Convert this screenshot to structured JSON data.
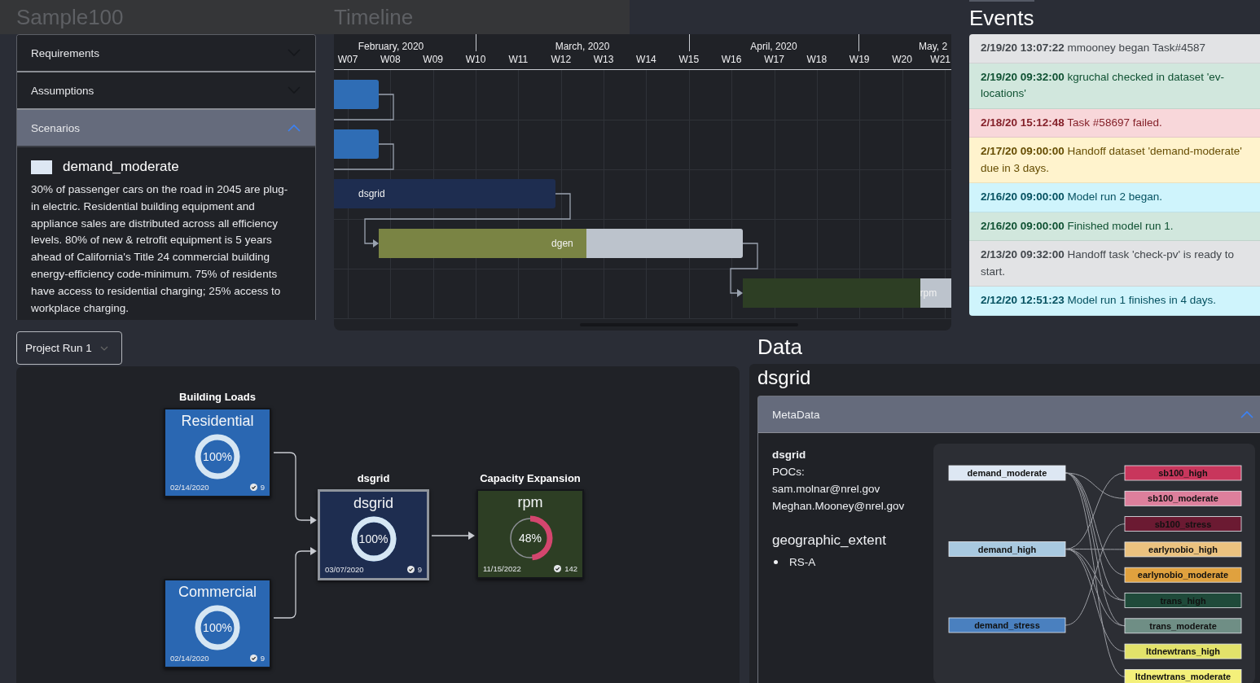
{
  "header": {
    "title": "Sample100"
  },
  "sidebar": {
    "sections": [
      {
        "label": "Requirements",
        "expanded": false
      },
      {
        "label": "Assumptions",
        "expanded": false
      },
      {
        "label": "Scenarios",
        "expanded": true
      }
    ],
    "scenario": {
      "name": "demand_moderate",
      "color": "#dde7f3",
      "description": "30% of passenger cars on the road in 2045 are plug-in electric. Residential building equipment and appliance sales are distributed across all efficiency levels. 80% of new & retrofit equipment is 5 years ahead of California's Title 24 commercial building energy-efficiency code-minimum. 75% of residents have access to residential charging; 25% access to workplace charging."
    }
  },
  "timeline": {
    "title": "Timeline",
    "months": [
      "February, 2020",
      "March, 2020",
      "April, 2020",
      "May, 2"
    ],
    "weeks": [
      "W07",
      "W08",
      "W09",
      "W10",
      "W11",
      "W12",
      "W13",
      "W14",
      "W15",
      "W16",
      "W17",
      "W18",
      "W19",
      "W20",
      "W21"
    ],
    "tasks": [
      {
        "color": "#2f6db5",
        "level": 1
      },
      {
        "color": "#2f6db5",
        "level": 1
      },
      {
        "label": "dsgrid",
        "color": "#1e2d50",
        "level": 1
      },
      {
        "label": "dgen",
        "color": "#7a8444",
        "level": 0.57
      },
      {
        "label": "rpm",
        "color": "#2d3e24",
        "level": 0.85
      }
    ]
  },
  "events": {
    "title": "Events",
    "items": [
      {
        "kind": "secondary",
        "time": "2/19/20 13:07:22",
        "text": "mmooney began Task#4587"
      },
      {
        "kind": "success",
        "time": "2/19/20 09:32:00",
        "text": "kgruchal checked in dataset 'ev-locations'"
      },
      {
        "kind": "danger",
        "time": "2/18/20 15:12:48",
        "text": "Task #58697 failed."
      },
      {
        "kind": "warning",
        "time": "2/17/20 09:00:00",
        "text": "Handoff dataset 'demand-moderate' due in 3 days."
      },
      {
        "kind": "info",
        "time": "2/16/20 09:00:00",
        "text": "Model run 2 began."
      },
      {
        "kind": "success",
        "time": "2/16/20 09:00:00",
        "text": "Finished model run 1."
      },
      {
        "kind": "secondary",
        "time": "2/13/20 09:32:00",
        "text": "Handoff task 'check-pv' is ready to start."
      },
      {
        "kind": "info",
        "time": "2/12/20 12:51:23",
        "text": "Model run 1 finishes in 4 days."
      }
    ]
  },
  "run_selector": {
    "value": "Project Run 1"
  },
  "workflow": {
    "nodes": [
      {
        "group": "Building Loads",
        "title": "Residential",
        "color": "#2a67b2",
        "kind": "single",
        "level": 1,
        "percent": "100%",
        "date": "02/14/2020",
        "count": "9"
      },
      {
        "title": "Commercial",
        "color": "#2a67b2",
        "kind": "single",
        "level": 1,
        "percent": "100%",
        "date": "02/14/2020",
        "count": "9"
      },
      {
        "group": "dsgrid",
        "title": "dsgrid",
        "color": "#1e2d50",
        "kind": "single",
        "level": 1,
        "percent": "100%",
        "date": "03/07/2020",
        "count": "9"
      },
      {
        "group": "Capacity Expansion",
        "title": "rpm",
        "color": "#2d3e24",
        "kind": "multi",
        "level": 0.48,
        "percent": "48%",
        "date": "11/15/2022",
        "count": "142"
      }
    ]
  },
  "data": {
    "title": "Data",
    "dataset": "dsgrid",
    "metadata": {
      "label": "MetaData",
      "expanded": true,
      "name": "dsgrid",
      "pocs_label": "POCs:",
      "pocs": [
        "sam.molnar@nrel.gov",
        "Meghan.Mooney@nrel.gov"
      ],
      "extent_title": "geographic_extent",
      "extent": [
        "RS-A"
      ]
    },
    "scenario_map": {
      "sources": [
        {
          "label": "demand_moderate",
          "color": "#dde7f3"
        },
        {
          "label": "demand_high",
          "color": "#a9c9e0"
        },
        {
          "label": "demand_stress",
          "color": "#4a80bf"
        }
      ],
      "targets": [
        {
          "label": "sb100_high",
          "color": "#c8365c"
        },
        {
          "label": "sb100_moderate",
          "color": "#dd7f9c"
        },
        {
          "label": "sb100_stress",
          "color": "#6b1a32"
        },
        {
          "label": "earlynobio_high",
          "color": "#ebc27f"
        },
        {
          "label": "earlynobio_moderate",
          "color": "#e0a13e"
        },
        {
          "label": "trans_high",
          "color": "#1f4a3a"
        },
        {
          "label": "trans_moderate",
          "color": "#6f8e85"
        },
        {
          "label": "ltdnewtrans_high",
          "color": "#e2e26a"
        },
        {
          "label": "ltdnewtrans_moderate",
          "color": "#f4f07a"
        }
      ]
    }
  }
}
